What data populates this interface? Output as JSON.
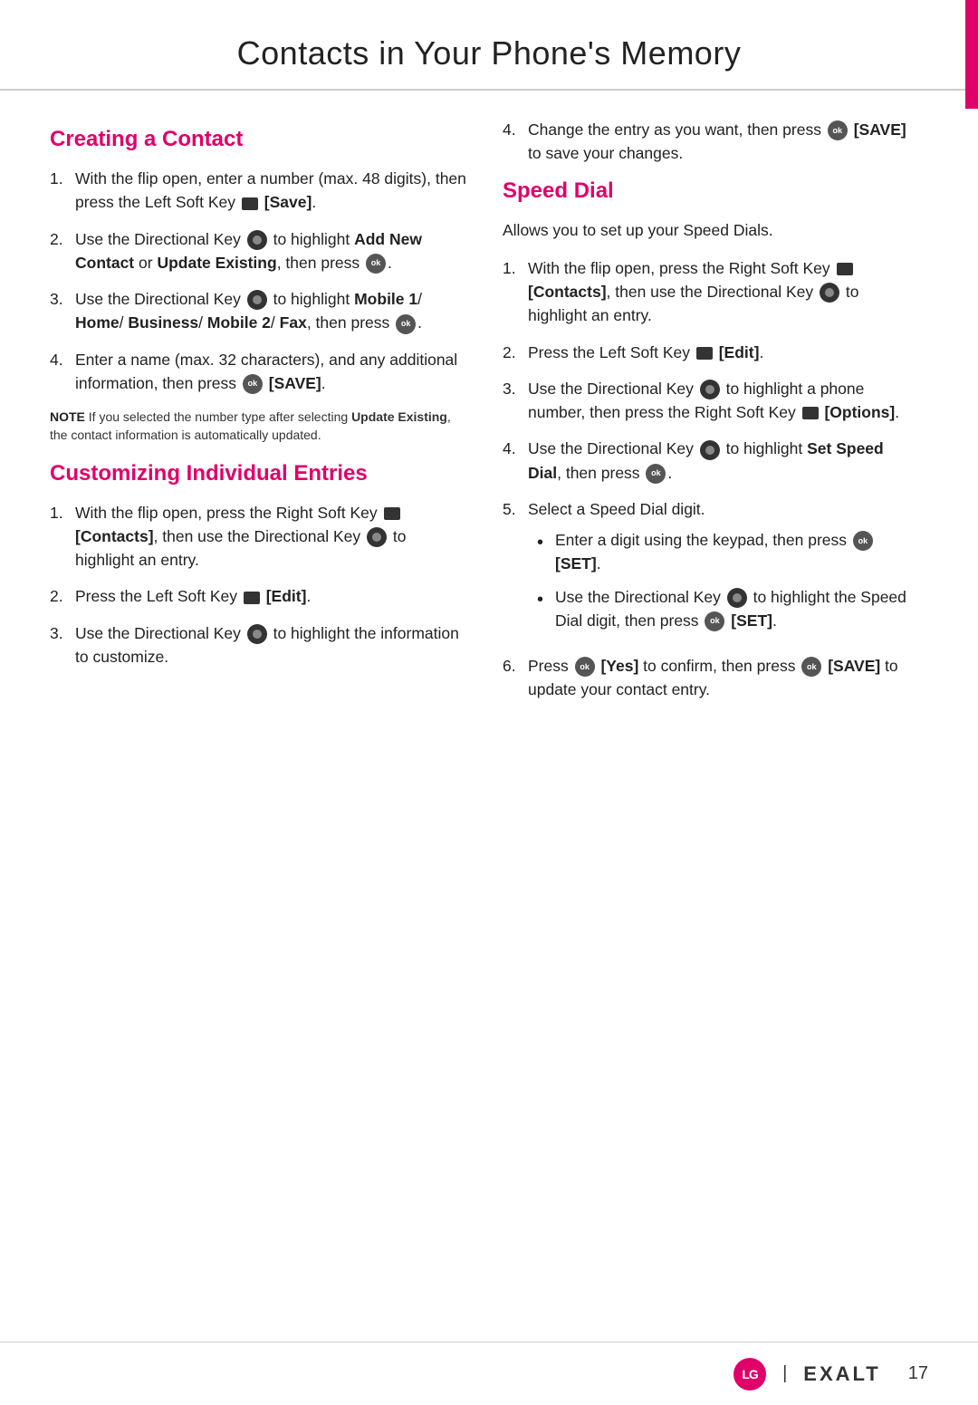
{
  "page": {
    "title": "Contacts in Your Phone's Memory",
    "page_number": "17",
    "brand": "EXALT"
  },
  "left_column": {
    "section1": {
      "title": "Creating a Contact",
      "items": [
        {
          "num": "1.",
          "text_parts": [
            {
              "type": "text",
              "content": "With the flip open, enter a number (max. 48 digits), then press the Left Soft Key "
            },
            {
              "type": "soft-key"
            },
            {
              "type": "bold",
              "content": " [Save]"
            },
            {
              "type": "text",
              "content": "."
            }
          ],
          "plain": "With the flip open, enter a number (max. 48 digits), then press the Left Soft Key [Save]."
        },
        {
          "num": "2.",
          "plain": "Use the Directional Key to highlight Add New Contact or Update Existing, then press."
        },
        {
          "num": "3.",
          "plain": "Use the Directional Key to highlight Mobile 1/ Home/ Business/ Mobile 2/ Fax, then press."
        },
        {
          "num": "4.",
          "plain": "Enter a name (max. 32 characters), and any additional information, then press [SAVE]."
        }
      ],
      "note": {
        "label": "NOTE",
        "text": " If you selected the number type after selecting Update Existing, the contact information is automatically updated."
      }
    },
    "section2": {
      "title": "Customizing Individual Entries",
      "items": [
        {
          "num": "1.",
          "plain": "With the flip open, press the Right Soft Key [Contacts], then use the Directional Key to highlight an entry."
        },
        {
          "num": "2.",
          "plain": "Press the Left Soft Key [Edit]."
        },
        {
          "num": "3.",
          "plain": "Use the Directional Key to highlight the information to customize."
        }
      ]
    }
  },
  "right_column": {
    "item_intro": {
      "num": "4.",
      "plain": "Change the entry as you want, then press [SAVE] to save your changes."
    },
    "section3": {
      "title": "Speed Dial",
      "intro": "Allows you to set up your Speed Dials.",
      "items": [
        {
          "num": "1.",
          "plain": "With the flip open, press the Right Soft Key [Contacts], then use the Directional Key to highlight an entry."
        },
        {
          "num": "2.",
          "plain": "Press the Left Soft Key [Edit]."
        },
        {
          "num": "3.",
          "plain": "Use the Directional Key to highlight a phone number, then press the Right Soft Key [Options]."
        },
        {
          "num": "4.",
          "plain": "Use the Directional Key to highlight Set Speed Dial, then press."
        },
        {
          "num": "5.",
          "plain": "Select a Speed Dial digit."
        }
      ],
      "bullets": [
        {
          "plain": "Enter a digit using the keypad, then press [SET]."
        },
        {
          "plain": "Use the Directional Key to highlight the Speed Dial digit, then press [SET]."
        }
      ],
      "item6": {
        "num": "6.",
        "plain": "Press [Yes] to confirm, then press [SAVE] to update your contact entry."
      }
    }
  }
}
